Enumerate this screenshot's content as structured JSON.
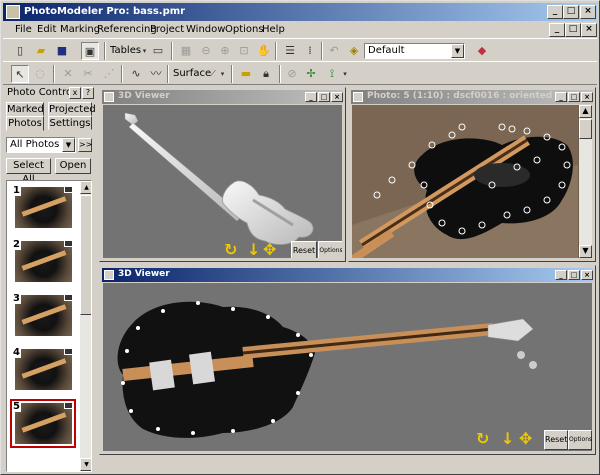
{
  "window": {
    "title": "PhotoModeler Pro: bass.pmr"
  },
  "menu": [
    "File",
    "Edit",
    "Marking",
    "Referencing",
    "Project",
    "Window",
    "Options",
    "Help"
  ],
  "toolbar": {
    "tables_label": "Tables",
    "surface_label": "Surface",
    "layer_value": "Default"
  },
  "left_panel": {
    "title": "Photo Control",
    "tabs": [
      "Marked",
      "Projected",
      "Photos",
      "Settings"
    ],
    "filter_value": "All Photos",
    "more_label": ">>",
    "select_all_label": "Select All",
    "open_label": "Open",
    "help_label": "?",
    "close_label": "x",
    "thumbnails": [
      {
        "number": "1"
      },
      {
        "number": "2"
      },
      {
        "number": "3"
      },
      {
        "number": "4"
      },
      {
        "number": "5"
      }
    ]
  },
  "viewer_top": {
    "title": "3D Viewer",
    "reset_label": "Reset",
    "options_label": "Options"
  },
  "photo_window": {
    "title": "Photo: 5 (1:10) : dscf0016 : oriented"
  },
  "viewer_main": {
    "title": "3D Viewer",
    "reset_label": "Reset",
    "options_label": "Options"
  },
  "colors": {
    "title_active": "#0a246a",
    "title_inactive": "#808080",
    "viewport": "#737373",
    "nav_controls": "#f0c800",
    "selected_thumb": "#c00000"
  },
  "icons": [
    "new-file-icon",
    "open-folder-icon",
    "save-icon",
    "photo-mode-icon",
    "tables-icon",
    "select-arrow-icon",
    "lasso-icon",
    "delete-icon",
    "line-icon",
    "curve-icon",
    "surface-icon",
    "ruler-icon",
    "lock-icon",
    "rotate-icon",
    "move-icon",
    "pan-icon"
  ]
}
